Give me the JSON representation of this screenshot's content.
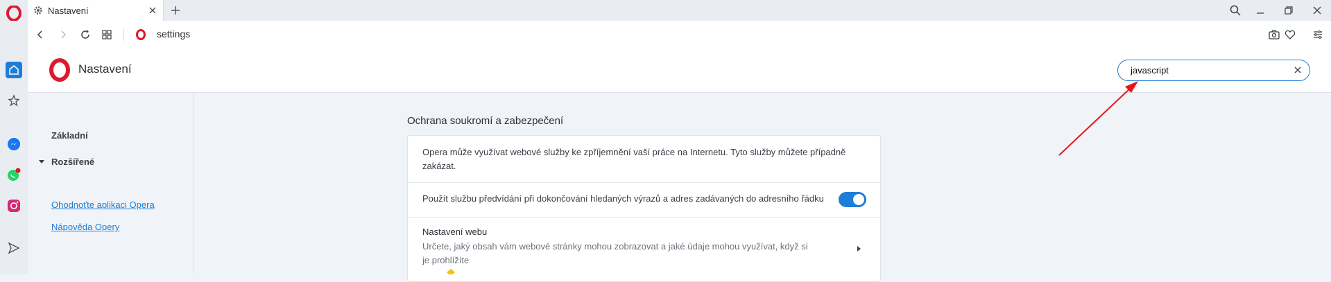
{
  "tab": {
    "title": "Nastavení"
  },
  "address": {
    "url": "settings"
  },
  "header": {
    "title": "Nastavení"
  },
  "search": {
    "value": "javascript"
  },
  "left_nav": {
    "items": [
      {
        "label": "Základní"
      },
      {
        "label": "Rozšířené"
      }
    ],
    "links": [
      {
        "label": "Ohodnoťte aplikaci Opera"
      },
      {
        "label": "Nápověda Opery"
      }
    ]
  },
  "section": {
    "title": "Ochrana soukromí a zabezpečení",
    "intro": "Opera může využívat webové služby ke zpříjemnění vaší práce na Internetu. Tyto služby můžete případně zakázat.",
    "prediction": {
      "label": "Použít službu předvídání při dokončování hledaných výrazů a adres zadávaných do adresního řádku",
      "enabled": true
    },
    "web_settings": {
      "title": "Nastavení webu",
      "description": "Určete, jaký obsah vám webové stránky mohou zobrazovat a jaké údaje mohou využívat, když si je prohlížíte"
    }
  },
  "colors": {
    "accent": "#1d7ed8",
    "opera_red": "#e0182e",
    "annotation_arrow": "#e8151b"
  },
  "icons": [
    "opera-logo-icon",
    "home-icon",
    "star-icon",
    "messenger-icon",
    "whatsapp-icon",
    "instagram-icon",
    "send-icon",
    "gear-icon",
    "close-icon",
    "plus-icon",
    "search-icon",
    "minimize-icon",
    "restore-icon",
    "back-icon",
    "forward-icon",
    "reload-icon",
    "speed-dial-icon",
    "camera-icon",
    "heart-icon",
    "easy-setup-icon",
    "clear-icon",
    "chevron-right-icon"
  ]
}
